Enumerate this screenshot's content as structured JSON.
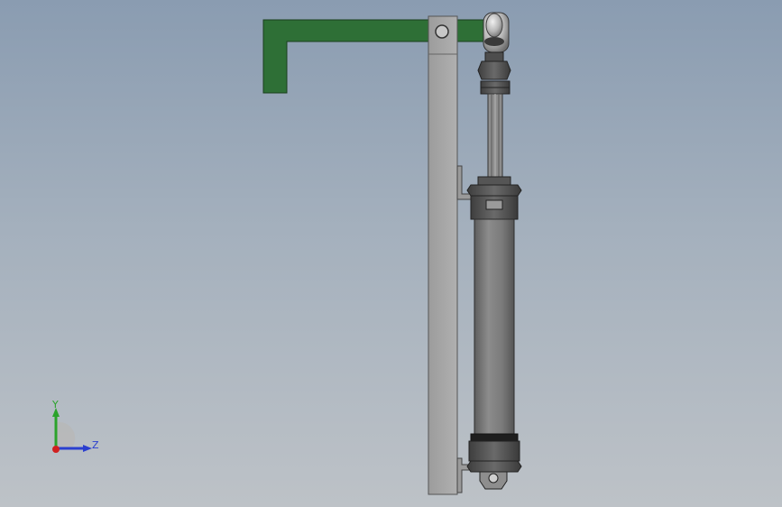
{
  "viewport": {
    "background_top": "#8a9cb1",
    "background_bottom": "#bdc2c7"
  },
  "model": {
    "parts": [
      {
        "name": "bracket",
        "color": "#2d6e35"
      },
      {
        "name": "vertical-plate",
        "color": "#a0a0a0"
      },
      {
        "name": "rod-end",
        "color": "#b0b0b0"
      },
      {
        "name": "piston-rod",
        "color": "#8a8a8a"
      },
      {
        "name": "cylinder-barrel",
        "color": "#7a7a7a"
      },
      {
        "name": "end-caps",
        "color": "#4a4a4a"
      }
    ]
  },
  "triad": {
    "y_label": "Y",
    "z_label": "Z",
    "y_color": "#2ba32b",
    "z_color": "#2a3fcf",
    "x_color": "#d02020"
  }
}
